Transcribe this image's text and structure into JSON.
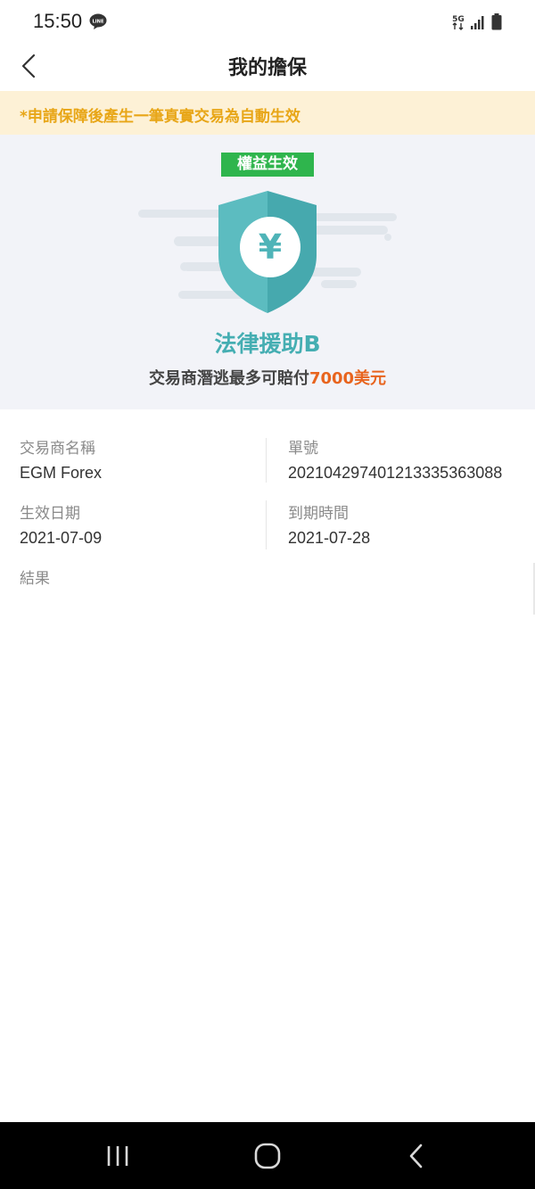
{
  "status_bar": {
    "time": "15:50",
    "line_badge": "LINE",
    "network": "5G"
  },
  "header": {
    "title": "我的擔保"
  },
  "notice": {
    "text": "*申請保障後產生一筆真實交易為自動生效"
  },
  "hero": {
    "badge": "權益生效",
    "icon_symbol": "¥",
    "plan_name": "法律援助B",
    "payout_prefix": "交易商潛逃最多可賠付",
    "payout_amount": "7000美元"
  },
  "details": {
    "broker_label": "交易商名稱",
    "broker_value": "EGM Forex",
    "order_label": "單號",
    "order_value": "20210429740121333536308​8",
    "start_label": "生效日期",
    "start_value": "2021-07-09",
    "end_label": "到期時間",
    "end_value": "2021-07-28",
    "result_label": "結果"
  },
  "colors": {
    "accent_teal": "#45aeb2",
    "badge_green": "#2fb54d",
    "notice_text": "#e8a617",
    "notice_bg": "#fdf1d6",
    "payout_orange": "#e8641e"
  }
}
